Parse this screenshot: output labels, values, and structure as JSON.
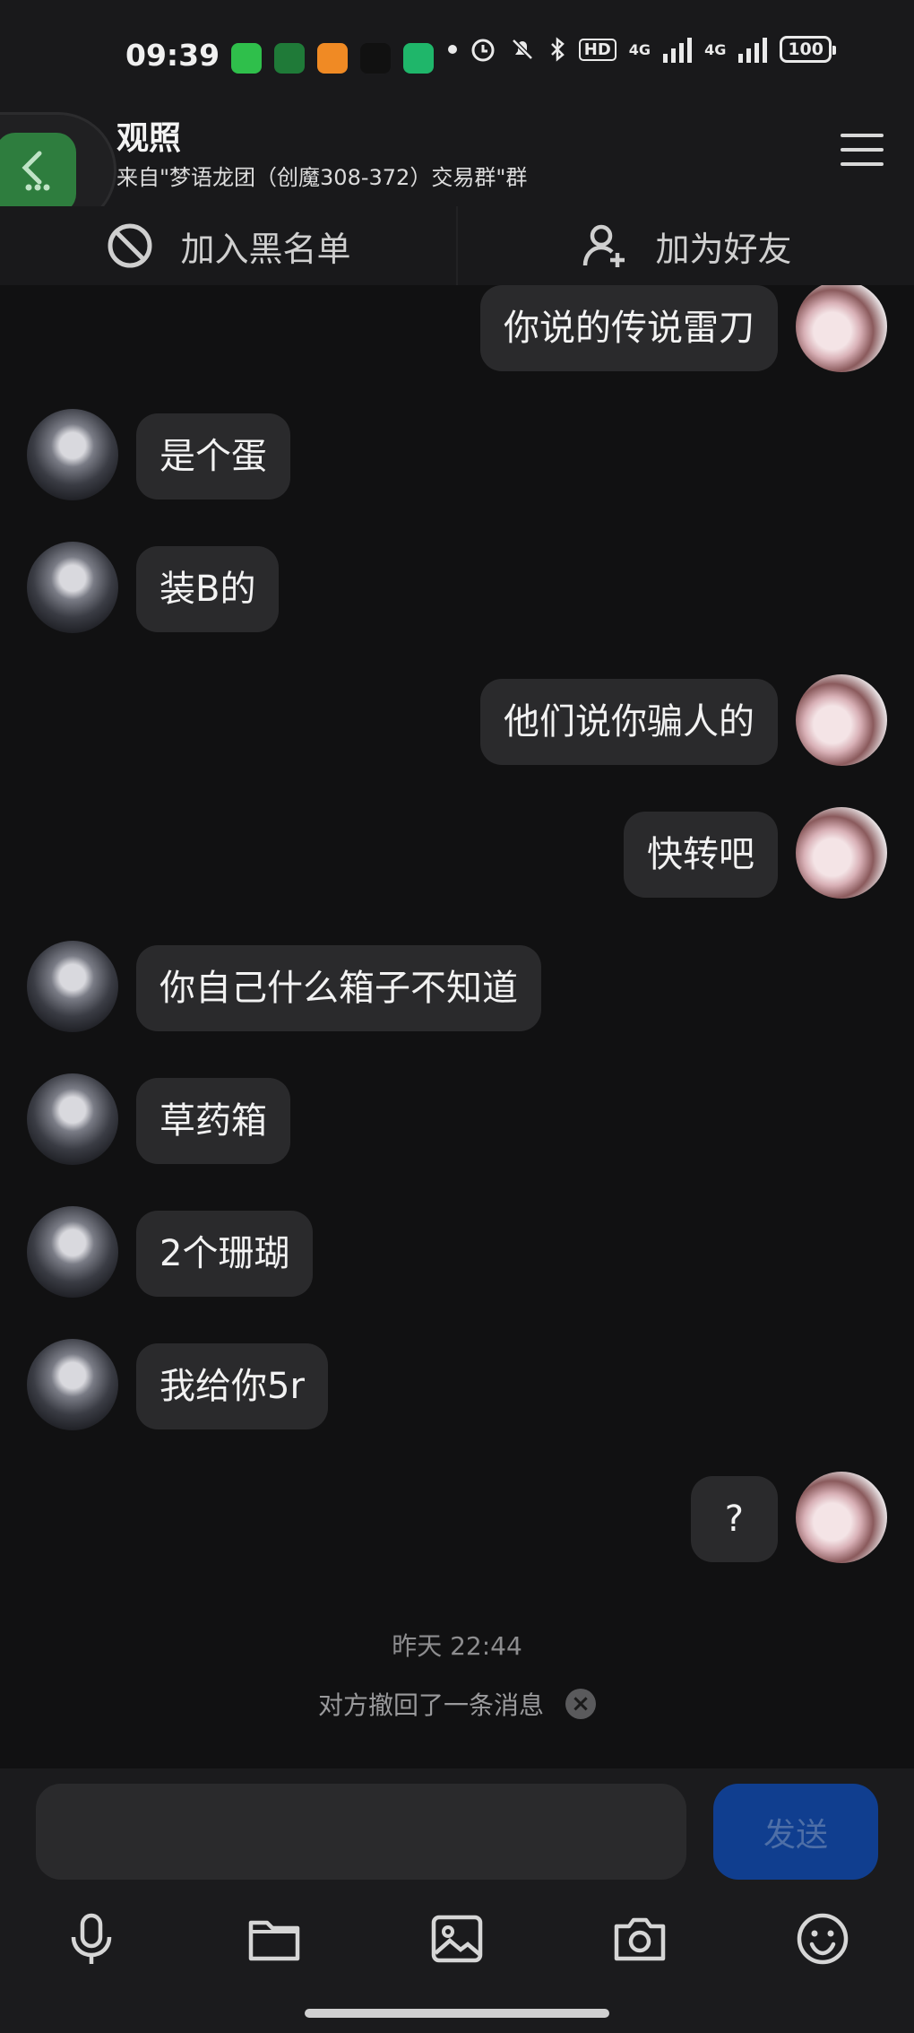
{
  "status_bar": {
    "time": "09:39",
    "hd_label": "HD",
    "net_a": "4G",
    "net_b": "4G",
    "battery": "100",
    "app_icon_colors": [
      "#2fbf4b",
      "#1f7a38",
      "#f08a24",
      "#111111",
      "#1fb66a"
    ]
  },
  "header": {
    "title": "观照",
    "subtitle": "来自\"梦语龙团（创魔308-372）交易群\"群"
  },
  "actions": {
    "blacklist_label": "加入黑名单",
    "add_friend_label": "加为好友"
  },
  "messages": [
    {
      "side": "right",
      "text": "你说的传说雷刀"
    },
    {
      "side": "left",
      "text": "是个蛋"
    },
    {
      "side": "left",
      "text": "装B的"
    },
    {
      "side": "right",
      "text": "他们说你骗人的"
    },
    {
      "side": "right",
      "text": "快转吧"
    },
    {
      "side": "left",
      "text": "你自己什么箱子不知道"
    },
    {
      "side": "left",
      "text": "草药箱"
    },
    {
      "side": "left",
      "text": "2个珊瑚"
    },
    {
      "side": "left",
      "text": "我给你5r"
    },
    {
      "side": "right",
      "text": "?"
    }
  ],
  "timestamp": "昨天 22:44",
  "recall_notice": "对方撤回了一条消息",
  "input": {
    "value": "",
    "send_label": "发送"
  },
  "toolbar_icons": [
    "mic-icon",
    "folder-icon",
    "image-icon",
    "camera-icon",
    "emoji-icon"
  ]
}
